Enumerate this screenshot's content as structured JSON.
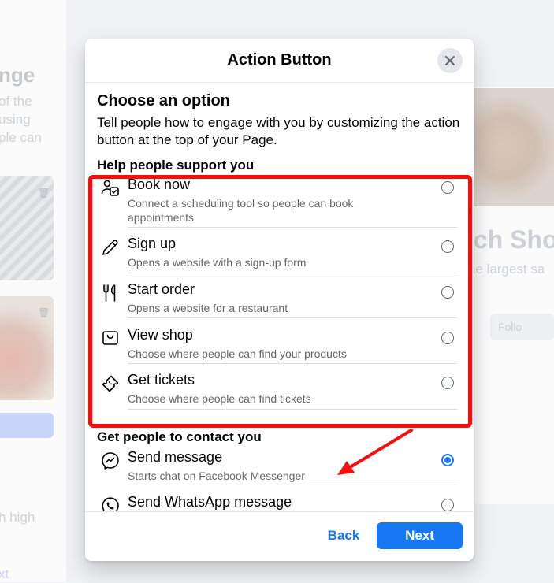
{
  "background": {
    "left_heading": "nge",
    "left_text_lines": [
      "of the",
      "using",
      "ple can"
    ],
    "left_bottom_text": "h high",
    "left_bottom_link": "xt",
    "page_name_partial": "ich Sho",
    "page_sub_partial": "he largest sa",
    "follow_partial": "Follo"
  },
  "modal": {
    "title": "Action Button",
    "close_icon": "close-icon",
    "section_title": "Choose an option",
    "description": "Tell people how to engage with you by customizing the action button at the top of your Page.",
    "groups": [
      {
        "title": "Help people support you",
        "options": [
          {
            "icon": "calendar-person-icon",
            "label": "Book now",
            "sub": "Connect a scheduling tool so people can book appointments",
            "selected": false
          },
          {
            "icon": "pencil-icon",
            "label": "Sign up",
            "sub": "Opens a website with a sign-up form",
            "selected": false
          },
          {
            "icon": "fork-knife-icon",
            "label": "Start order",
            "sub": "Opens a website for a restaurant",
            "selected": false
          },
          {
            "icon": "shopping-bag-icon",
            "label": "View shop",
            "sub": "Choose where people can find your products",
            "selected": false
          },
          {
            "icon": "ticket-icon",
            "label": "Get tickets",
            "sub": "Choose where people can find tickets",
            "selected": false
          }
        ]
      },
      {
        "title": "Get people to contact you",
        "options": [
          {
            "icon": "messenger-icon",
            "label": "Send message",
            "sub": "Starts chat on Facebook Messenger",
            "selected": true
          },
          {
            "icon": "whatsapp-icon",
            "label": "Send WhatsApp message",
            "sub": "",
            "selected": false
          }
        ]
      }
    ],
    "back_label": "Back",
    "next_label": "Next"
  },
  "annotation": {
    "highlight_color": "#f50f0f",
    "arrow_color": "#f50f0f"
  },
  "colors": {
    "accent": "#1877f2",
    "secondary_text": "#65676b"
  }
}
